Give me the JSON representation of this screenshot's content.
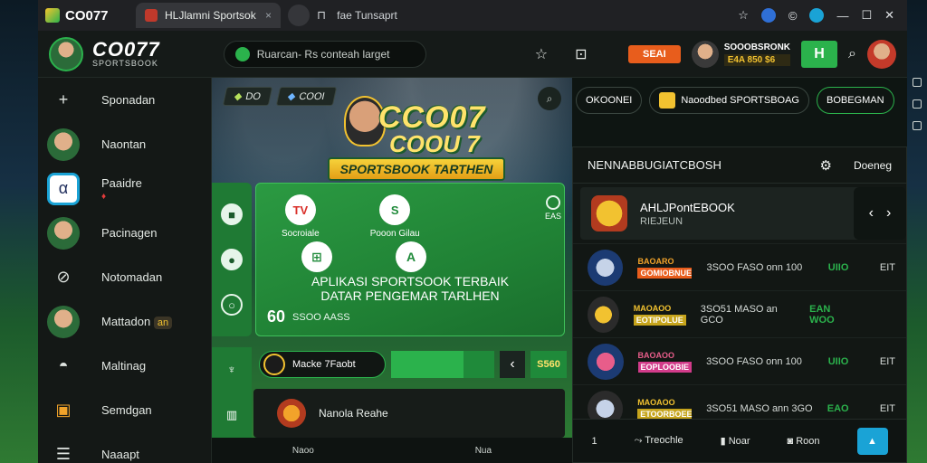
{
  "browser": {
    "brand": "CO077",
    "tab_title": "HLJlamni Sportsok",
    "address": "fae Tunsaprt",
    "tab_icon": "tab-icon"
  },
  "header": {
    "logo_title": "CO077",
    "logo_sub": "SPORTSBOOK",
    "search_text": "Ruarcan- Rs conteah larget",
    "button_label": "SEAI",
    "user_name": "SOOOBSRONK",
    "user_balance": "E4A 850 $6",
    "green_button": "H"
  },
  "sidebar": {
    "items": [
      {
        "label": "Sponadan",
        "icon": "plus-icon"
      },
      {
        "label": "Naontan",
        "icon": "avatar"
      },
      {
        "label": "Paaidre",
        "icon": "slash-icon",
        "badge": "♦"
      },
      {
        "label": "Pacinagen",
        "icon": "avatar"
      },
      {
        "label": "Notomadan",
        "icon": "shield-icon"
      },
      {
        "label": "Mattadon",
        "icon": "avatar",
        "chip": "an"
      },
      {
        "label": "Maltinag",
        "icon": "helmet-icon"
      },
      {
        "label": "Semdgan",
        "icon": "trophy-icon"
      },
      {
        "label": "Naaapt",
        "icon": "gift-icon"
      }
    ]
  },
  "stadium": {
    "chip1": "DO",
    "chip2": "COOI",
    "logo_word1": "CCO07",
    "logo_word2": "COOU 7",
    "logo_banner": "SPORTSBOOK TARTHEN",
    "apps": [
      {
        "label": "Socroiale",
        "glyph": "TV"
      },
      {
        "label": "Pooon Gilau",
        "glyph": "S"
      }
    ],
    "headline1": "APLIKASI SPORTSOOK TERBAIK",
    "headline2": "DATAR PENGEMAR TARLHEN",
    "odds": "60",
    "odds_sub": "SSOO AASS",
    "side_tag": "EAS",
    "bet_label": "Macke 7Faobt",
    "bet_value": "S560",
    "match_title": "Nanola Reahe",
    "bottom_left": "Naoo",
    "bottom_right": "Nua"
  },
  "topright": {
    "btn1": "OKOONEI",
    "btn2": "Naoodbed  SPORTSBOAG",
    "btn3": "BOBEGMAN"
  },
  "rpanel": {
    "title": "NENNABBUGIATCBOSH",
    "more": "Doeneg",
    "featured_title": "AHLJPontEBOOK",
    "featured_sub": "RIEJEUN",
    "rows": [
      {
        "tag_a": "BAOARO",
        "tag_b": "GOMIOBNUE",
        "tag_b_color": "#e85d1c",
        "info": "3SOO FASO onn 100",
        "val": "UIIO",
        "extra": "EIT"
      },
      {
        "tag_a": "MAOAOO",
        "tag_b": "EOTIPOLUE",
        "tag_b_color": "#c6a41c",
        "info": "3SO51 MASO an GCO",
        "val": "EAN WOO",
        "extra": ""
      },
      {
        "tag_a": "BAOAOO",
        "tag_b": "EOPLOOBIE",
        "tag_b_color": "#d23b8a",
        "info": "3SOO FASO onn 100",
        "val": "UIIO",
        "extra": "EIT"
      },
      {
        "tag_a": "MAOAOO",
        "tag_b": "ETOORBOEE",
        "tag_b_color": "#c6a41c",
        "info": "3SO51 MASO ann 3GO",
        "val": "EAO",
        "extra": "EIT"
      }
    ],
    "bottom": {
      "b1": "1",
      "b2": "Treochle",
      "b3": "Noar",
      "b4": "Roon"
    }
  }
}
